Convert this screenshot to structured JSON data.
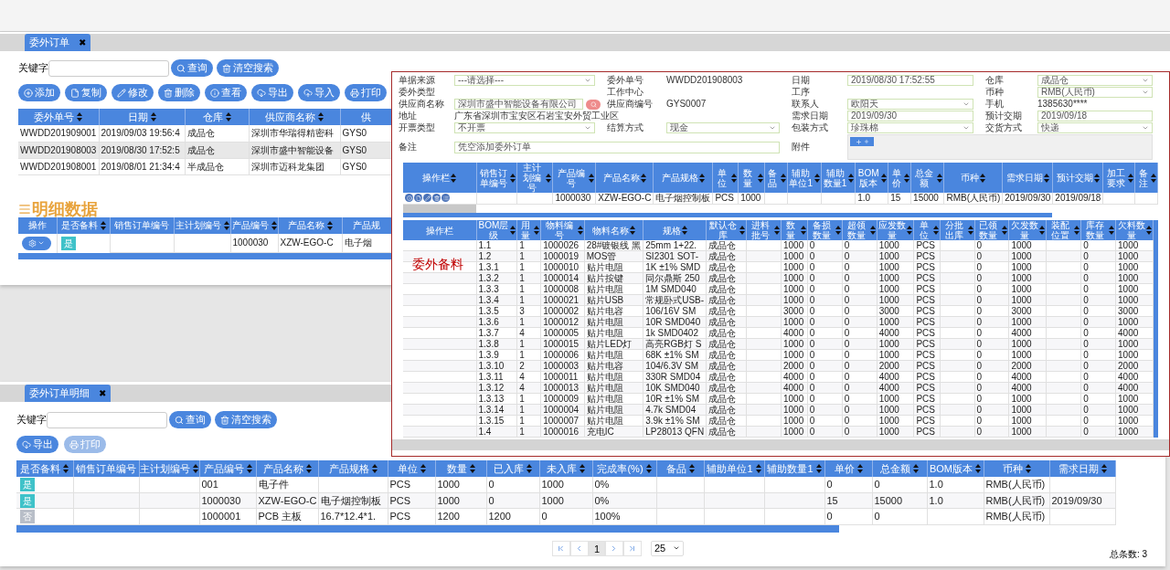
{
  "orders_page": {
    "tab": {
      "label": "委外订单",
      "close": "✖"
    },
    "search": {
      "label": "关键字",
      "buttons": [
        "查询",
        "清空搜索"
      ]
    },
    "toolbar": [
      {
        "label": "添加"
      },
      {
        "label": "复制"
      },
      {
        "label": "修改"
      },
      {
        "label": "删除"
      },
      {
        "label": "查看"
      },
      {
        "label": "导出"
      },
      {
        "label": "导入"
      },
      {
        "label": "打印"
      }
    ],
    "orders_table": {
      "columns": [
        {
          "label": "委外单号",
          "sortable": true
        },
        {
          "label": "日期",
          "sortable": true
        },
        {
          "label": "仓库",
          "sortable": true
        },
        {
          "label": "供应商名称",
          "sortable": true
        },
        {
          "label": "供",
          "sortable": false
        }
      ],
      "rows": [
        {
          "selected": false,
          "cells": [
            "WWDD201909001",
            "2019/09/03 19:56:4",
            "成品仓",
            "深圳市华瑞得精密科",
            "GYS0"
          ]
        },
        {
          "selected": true,
          "cells": [
            "WWDD201908003",
            "2019/08/30 17:52:5",
            "成品仓",
            "深圳市盛中智能设备",
            "GYS0"
          ]
        },
        {
          "selected": false,
          "cells": [
            "WWDD201908001",
            "2019/08/01 21:34:4",
            "半成品仓",
            "深圳市迈科龙集团",
            "GYS0"
          ]
        }
      ]
    },
    "detail_title": "明细数据",
    "detail_table": {
      "columns": [
        {
          "label": "操作",
          "sortable": false
        },
        {
          "label": "是否备料",
          "sortable": true
        },
        {
          "label": "销售订单编号",
          "sortable": false
        },
        {
          "label": "主计划编号",
          "sortable": true
        },
        {
          "label": "产品编号",
          "sortable": true
        },
        {
          "label": "产品名称",
          "sortable": true
        },
        {
          "label": "产品规",
          "sortable": false
        }
      ],
      "rows": [
        {
          "cells": [
            "",
            {
              "label": "是",
              "on": true
            },
            "",
            "",
            "1000030",
            "XZW-EGO-C",
            "电子烟"
          ]
        }
      ]
    }
  },
  "overlay": {
    "form": [
      [
        {
          "label": "单据来源",
          "kind": "select",
          "value": "---请选择---"
        },
        {
          "label": "委外单号",
          "kind": "text",
          "value": "WWDD201908003"
        },
        {
          "label": "日期",
          "kind": "input",
          "value": "2019/08/30 17:52:55"
        },
        {
          "label": "仓库",
          "kind": "select",
          "value": "成品仓"
        }
      ],
      [
        {
          "label": "委外类型",
          "kind": "text"
        },
        {
          "label": "工作中心",
          "kind": "text"
        },
        {
          "label": "工序",
          "kind": "text"
        },
        {
          "label": "币种",
          "kind": "select",
          "value": "RMB(人民币)"
        }
      ],
      [
        {
          "label": "供应商名称",
          "kind": "search",
          "value": "深圳市盛中智能设备有限公司"
        },
        {
          "label": "供应商编号",
          "kind": "text",
          "value": "GYS0007"
        },
        {
          "label": "联系人",
          "kind": "select",
          "value": "欧阳天"
        },
        {
          "label": "手机",
          "kind": "text",
          "value": "1385630****"
        }
      ],
      [
        {
          "label": "地址",
          "kind": "wide_text",
          "value": "广东省深圳市宝安区石岩宝安外贸工业区"
        },
        {
          "label": "需求日期",
          "kind": "input",
          "value": "2019/09/30"
        },
        {
          "label": "预计交期",
          "kind": "input",
          "value": "2019/09/18"
        }
      ],
      [
        {
          "label": "开票类型",
          "kind": "select",
          "value": "不开票"
        },
        {
          "label": "结算方式",
          "kind": "select",
          "value": "现金"
        },
        {
          "label": "包装方式",
          "kind": "select",
          "value": "珍珠棉"
        },
        {
          "label": "交货方式",
          "kind": "select",
          "value": "快递"
        }
      ],
      [
        {
          "label": "备注",
          "kind": "textarea",
          "value": "凭空添加委外订单"
        },
        {
          "label": "附件",
          "kind": "upload"
        }
      ]
    ],
    "items_table": {
      "columns": [
        "操作栏",
        "销售订单编号",
        "主计划编号",
        "产品编号",
        "产品名称",
        "产品规格",
        "单位",
        "数量",
        "备品",
        "辅助单位1",
        "辅助数量1",
        "BOM版本",
        "单价",
        "总金额",
        "币种",
        "需求日期",
        "预计交期",
        "加工要求",
        "备注"
      ],
      "rows": [
        [
          "",
          "",
          "",
          "1000030",
          "XZW-EGO-C",
          "电子烟控制板",
          "PCS",
          "1000",
          "",
          "",
          "",
          "1.0",
          "15",
          "15000",
          "RMB(人民币)",
          "2019/09/30",
          "2019/09/18",
          "",
          ""
        ]
      ]
    },
    "annotation": "委外备料",
    "bom_table": {
      "columns": [
        "操作栏",
        "BOM层级",
        "用量",
        "物料编号",
        "物料名称",
        "规格",
        "默认仓库",
        "进料批号",
        "数量",
        "备损数量",
        "超领数量",
        "应发数量",
        "单位",
        "分批出库",
        "已领数量",
        "欠发数量",
        "装配位置",
        "库存数量",
        "欠料数量"
      ],
      "rows": [
        [
          "",
          "1.1",
          "1",
          "1000026",
          "28#镀银线 黑",
          "25mm 1+22.",
          "成品仓",
          "",
          "1000",
          "0",
          "0",
          "1000",
          "PCS",
          "",
          "0",
          "1000",
          "",
          "0",
          "1000"
        ],
        [
          "",
          "1.2",
          "1",
          "1000019",
          "MOS管",
          "SI2301 SOT-",
          "成品仓",
          "",
          "1000",
          "0",
          "0",
          "1000",
          "PCS",
          "",
          "0",
          "1000",
          "",
          "0",
          "1000"
        ],
        [
          "",
          "1.3.1",
          "1",
          "1000010",
          "贴片电阻",
          "1K ±1% SMD",
          "成品仓",
          "",
          "1000",
          "0",
          "0",
          "1000",
          "PCS",
          "",
          "0",
          "1000",
          "",
          "0",
          "1000"
        ],
        [
          "",
          "1.3.2",
          "1",
          "1000014",
          "贴片按键",
          "同尔鼎斯 250",
          "成品仓",
          "",
          "1000",
          "0",
          "0",
          "1000",
          "PCS",
          "",
          "0",
          "1000",
          "",
          "0",
          "1000"
        ],
        [
          "",
          "1.3.3",
          "1",
          "1000008",
          "贴片电阻",
          "1M SMD040",
          "成品仓",
          "",
          "1000",
          "0",
          "0",
          "1000",
          "PCS",
          "",
          "0",
          "1000",
          "",
          "0",
          "1000"
        ],
        [
          "",
          "1.3.4",
          "1",
          "1000021",
          "贴片USB",
          "常规卧式USB-",
          "成品仓",
          "",
          "1000",
          "0",
          "0",
          "1000",
          "PCS",
          "",
          "0",
          "1000",
          "",
          "0",
          "1000"
        ],
        [
          "",
          "1.3.5",
          "3",
          "1000002",
          "贴片电容",
          "106/16V SM",
          "成品仓",
          "",
          "3000",
          "0",
          "0",
          "3000",
          "PCS",
          "",
          "0",
          "3000",
          "",
          "0",
          "3000"
        ],
        [
          "",
          "1.3.6",
          "1",
          "1000012",
          "贴片电阻",
          "10R SMD040",
          "成品仓",
          "",
          "1000",
          "0",
          "0",
          "1000",
          "PCS",
          "",
          "0",
          "1000",
          "",
          "0",
          "1000"
        ],
        [
          "",
          "1.3.7",
          "4",
          "1000005",
          "贴片电阻",
          "1k SMD0402",
          "成品仓",
          "",
          "4000",
          "0",
          "0",
          "4000",
          "PCS",
          "",
          "0",
          "4000",
          "",
          "0",
          "4000"
        ],
        [
          "",
          "1.3.8",
          "1",
          "1000015",
          "贴片LED灯",
          "高亮RGB灯 S",
          "成品仓",
          "",
          "1000",
          "0",
          "0",
          "1000",
          "PCS",
          "",
          "0",
          "1000",
          "",
          "0",
          "1000"
        ],
        [
          "",
          "1.3.9",
          "1",
          "1000006",
          "贴片电阻",
          "68K ±1% SM",
          "成品仓",
          "",
          "1000",
          "0",
          "0",
          "1000",
          "PCS",
          "",
          "0",
          "1000",
          "",
          "0",
          "1000"
        ],
        [
          "",
          "1.3.10",
          "2",
          "1000003",
          "贴片电容",
          "104/6.3V SM",
          "成品仓",
          "",
          "2000",
          "0",
          "0",
          "2000",
          "PCS",
          "",
          "0",
          "2000",
          "",
          "0",
          "2000"
        ],
        [
          "",
          "1.3.11",
          "4",
          "1000011",
          "贴片电阻",
          "330R SMD04",
          "成品仓",
          "",
          "4000",
          "0",
          "0",
          "4000",
          "PCS",
          "",
          "0",
          "4000",
          "",
          "0",
          "4000"
        ],
        [
          "",
          "1.3.12",
          "4",
          "1000013",
          "贴片电阻",
          "10K SMD040",
          "成品仓",
          "",
          "4000",
          "0",
          "0",
          "4000",
          "PCS",
          "",
          "0",
          "4000",
          "",
          "0",
          "4000"
        ],
        [
          "",
          "1.3.13",
          "1",
          "1000009",
          "贴片电阻",
          "10R ±1% SM",
          "成品仓",
          "",
          "1000",
          "0",
          "0",
          "1000",
          "PCS",
          "",
          "0",
          "1000",
          "",
          "0",
          "1000"
        ],
        [
          "",
          "1.3.14",
          "1",
          "1000004",
          "贴片电阻",
          "4.7k SMD04",
          "成品仓",
          "",
          "1000",
          "0",
          "0",
          "1000",
          "PCS",
          "",
          "0",
          "1000",
          "",
          "0",
          "1000"
        ],
        [
          "",
          "1.3.15",
          "1",
          "1000007",
          "贴片电阻",
          "3.9k ±1% SM",
          "成品仓",
          "",
          "1000",
          "0",
          "0",
          "1000",
          "PCS",
          "",
          "0",
          "1000",
          "",
          "0",
          "1000"
        ],
        [
          "",
          "1.4",
          "1",
          "1000016",
          "充电IC",
          "LP28013 QFN",
          "成品仓",
          "",
          "1000",
          "0",
          "0",
          "1000",
          "PCS",
          "",
          "0",
          "1000",
          "",
          "0",
          "1000"
        ]
      ]
    }
  },
  "detail_page": {
    "tab": {
      "label": "委外订单明细",
      "close": "✖"
    },
    "search": {
      "label": "关键字",
      "buttons": [
        "查询",
        "清空搜索"
      ]
    },
    "toolbar": [
      {
        "label": "导出",
        "disabled": false
      },
      {
        "label": "打印",
        "disabled": true
      }
    ],
    "table": {
      "columns": [
        {
          "label": "是否备料",
          "sortable": true
        },
        {
          "label": "销售订单编号",
          "sortable": false
        },
        {
          "label": "主计划编号",
          "sortable": true
        },
        {
          "label": "产品编号",
          "sortable": true
        },
        {
          "label": "产品名称",
          "sortable": true
        },
        {
          "label": "产品规格",
          "sortable": true
        },
        {
          "label": "单位",
          "sortable": true
        },
        {
          "label": "数量",
          "sortable": true
        },
        {
          "label": "已入库",
          "sortable": true
        },
        {
          "label": "未入库",
          "sortable": true
        },
        {
          "label": "完成率(%)",
          "sortable": true
        },
        {
          "label": "备品",
          "sortable": true
        },
        {
          "label": "辅助单位1",
          "sortable": true
        },
        {
          "label": "辅助数量1",
          "sortable": true
        },
        {
          "label": "单价",
          "sortable": true
        },
        {
          "label": "总金额",
          "sortable": true
        },
        {
          "label": "BOM版本",
          "sortable": true
        },
        {
          "label": "币种",
          "sortable": true
        },
        {
          "label": "需求日期",
          "sortable": true
        }
      ],
      "rows": [
        {
          "cells": [
            {
              "label": "是",
              "on": true
            },
            "",
            "",
            "001",
            "电子件",
            "",
            "PCS",
            "1000",
            "0",
            "1000",
            "0%",
            "",
            "",
            "",
            "0",
            "0",
            "1.0",
            "RMB(人民币)",
            ""
          ]
        },
        {
          "cells": [
            {
              "label": "是",
              "on": true
            },
            "",
            "",
            "1000030",
            "XZW-EGO-C",
            "电子烟控制板",
            "PCS",
            "1000",
            "0",
            "1000",
            "0%",
            "",
            "",
            "",
            "15",
            "15000",
            "1.0",
            "RMB(人民币)",
            "2019/09/30"
          ]
        },
        {
          "cells": [
            {
              "label": "否",
              "on": false
            },
            "",
            "",
            "1000001",
            "PCB 主板",
            "16.7*12.4*1.",
            "PCS",
            "1200",
            "1200",
            "0",
            "100%",
            "",
            "",
            "",
            "0",
            "0",
            "",
            "RMB(人民币)",
            ""
          ]
        }
      ]
    },
    "pagination": {
      "pages": [
        {
          "label": "1",
          "selected": true
        }
      ],
      "page_size": "25",
      "total": "总条数: 3"
    }
  }
}
